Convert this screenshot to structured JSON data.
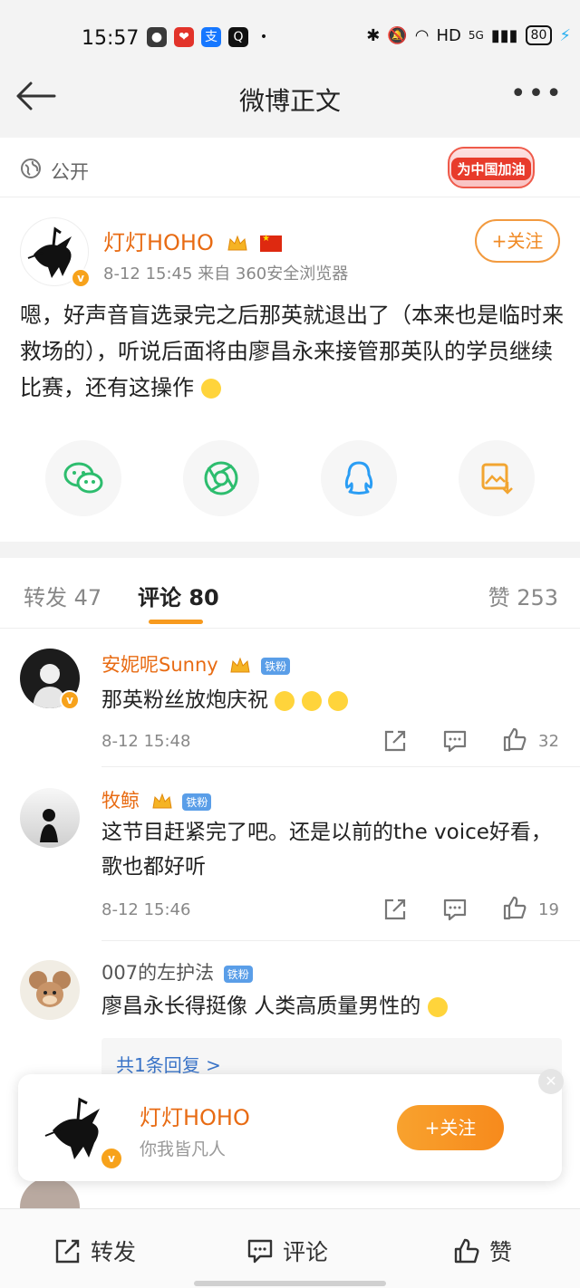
{
  "status_bar": {
    "time": "15:57",
    "network": "HD",
    "signal": "5G",
    "battery": "80"
  },
  "header": {
    "title": "微博正文"
  },
  "post": {
    "visibility": "公开",
    "badge": "为中国加油",
    "author": {
      "name": "灯灯HOHO"
    },
    "meta": "8-12 15:45  来自 360安全浏览器",
    "follow_label": "+关注",
    "text": "嗯，好声音盲选录完之后那英就退出了（本来也是临时来救场的），听说后面将由廖昌永来接管那英队的学员继续比赛，还有这操作"
  },
  "tabs": [
    {
      "label": "转发 47"
    },
    {
      "label": "评论 80"
    },
    {
      "label": "赞 253"
    }
  ],
  "comments": [
    {
      "name": "安妮呢Sunny",
      "badge": "铁粉",
      "text": "那英粉丝放炮庆祝",
      "time": "8-12 15:48",
      "likes": "32"
    },
    {
      "name": "牧鲸",
      "badge": "铁粉",
      "text": "这节目赶紧完了吧。还是以前的the voice好看，歌也都好听",
      "time": "8-12 15:46",
      "likes": "19"
    },
    {
      "name": "007的左护法",
      "badge": "铁粉",
      "text": "廖昌永长得挺像 人类高质量男性的",
      "reply": "共1条回复 >"
    }
  ],
  "float_card": {
    "name": "灯灯HOHO",
    "subtitle": "你我皆凡人",
    "follow_label": "+关注"
  },
  "bottom_bar": {
    "repost": "转发",
    "comment": "评论",
    "like": "赞"
  },
  "colors": {
    "accent": "#f79a1e",
    "name": "#e86b13",
    "verified": "#f7a21b"
  }
}
